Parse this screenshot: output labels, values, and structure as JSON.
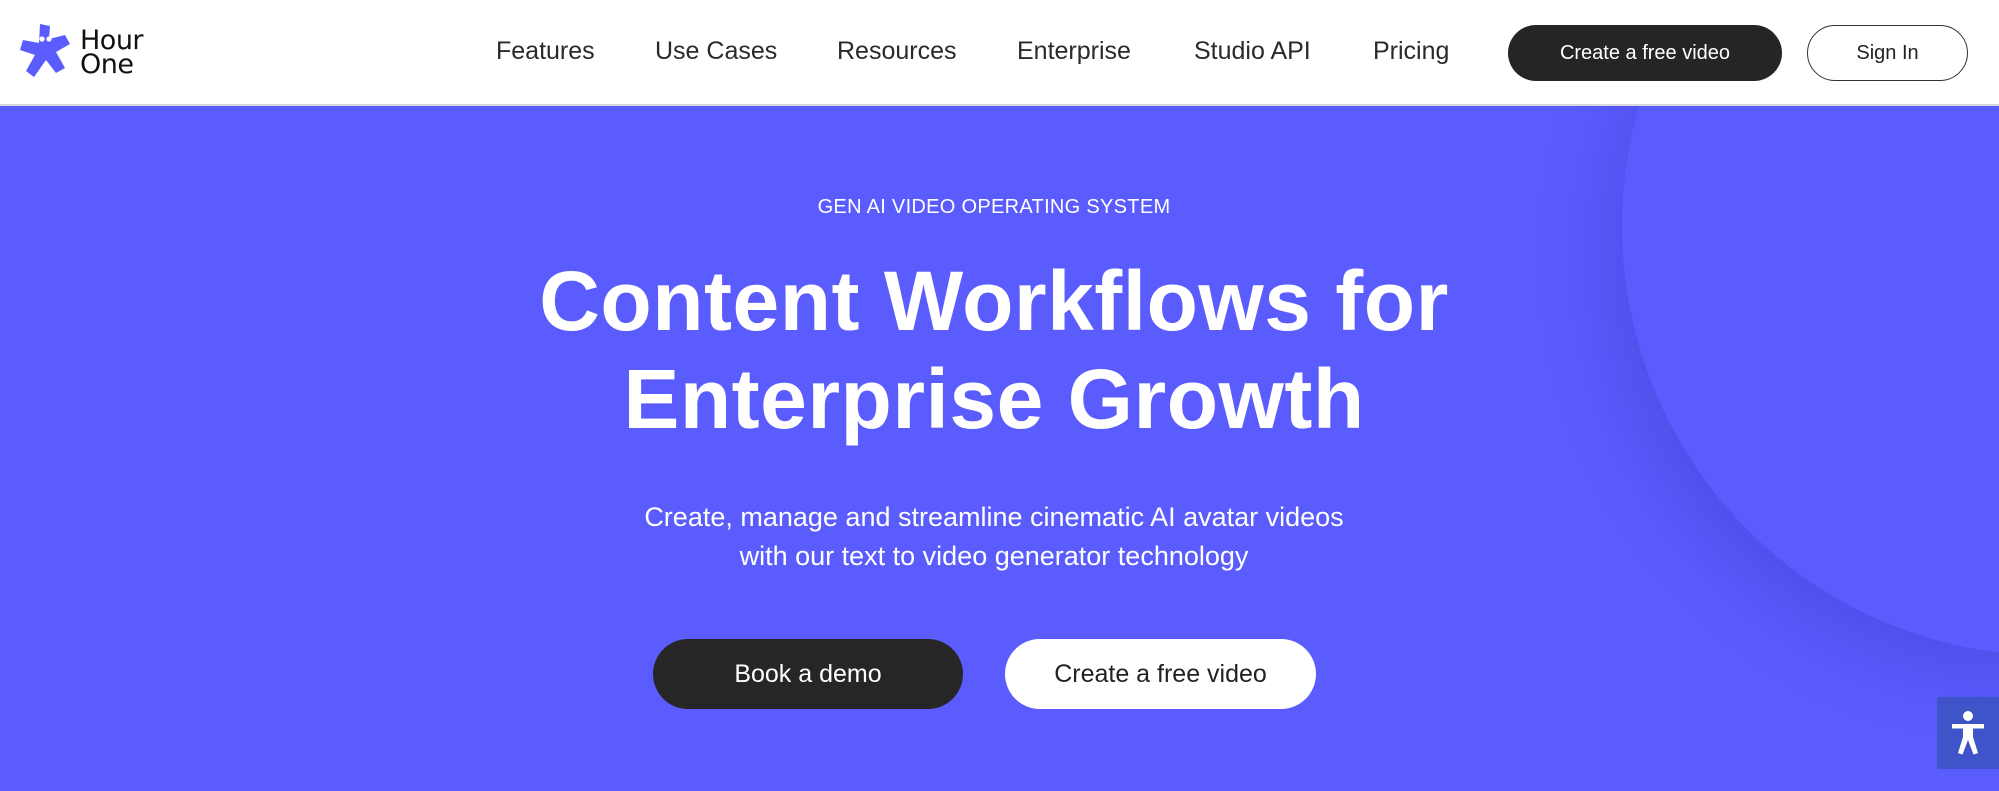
{
  "brand": {
    "name_line1": "Hour",
    "name_line2": "One",
    "logo_icon": "star-character-icon",
    "logo_color": "#5b5cfe"
  },
  "nav": {
    "items": [
      {
        "label": "Features"
      },
      {
        "label": "Use Cases"
      },
      {
        "label": "Resources"
      },
      {
        "label": "Enterprise"
      },
      {
        "label": "Studio API"
      },
      {
        "label": "Pricing"
      }
    ],
    "cta_primary": "Create a free video",
    "cta_secondary": "Sign In"
  },
  "hero": {
    "eyebrow": "GEN AI VIDEO OPERATING SYSTEM",
    "headline_line1": "Content Workflows for",
    "headline_line2": "Enterprise Growth",
    "subtext_line1": "Create, manage and streamline cinematic AI avatar videos",
    "subtext_line2": "with our text to video generator technology",
    "cta_demo": "Book a demo",
    "cta_free": "Create a free video",
    "background_color": "#5b5cfe"
  },
  "accessibility": {
    "icon": "accessibility-icon"
  }
}
